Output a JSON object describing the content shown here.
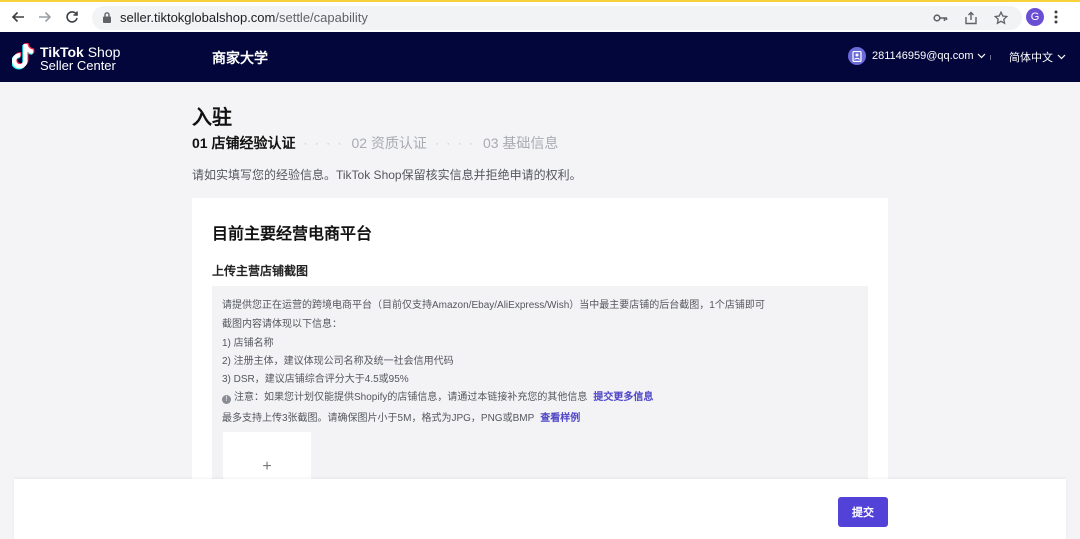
{
  "browser": {
    "url_host": "seller.tiktokglobalshop.com",
    "url_path": "/settle/capability",
    "profile_initial": "G",
    "icons": [
      "back-icon",
      "forward-icon",
      "reload-icon",
      "lock-icon",
      "key-icon",
      "share-icon",
      "star-icon",
      "kebab-menu-icon"
    ]
  },
  "header": {
    "brand_line1_bold": "TikTok",
    "brand_line1_thin": " Shop",
    "brand_line2": "Seller Center",
    "nav_university": "商家大学",
    "account_email": "281146959@qq.com",
    "language": "简体中文",
    "colors": {
      "background": "#03063a",
      "avatar": "#6a6bd8"
    }
  },
  "page": {
    "title": "入驻",
    "steps": [
      {
        "label": "01 店铺经验认证",
        "active": true
      },
      {
        "label": "02 资质认证",
        "active": false
      },
      {
        "label": "03 基础信息",
        "active": false
      }
    ],
    "step_separator": "· · · ·",
    "notice": "请如实填写您的经验信息。TikTok Shop保留核实信息并拒绝申请的权利。"
  },
  "card": {
    "title": "目前主要经营电商平台",
    "section_title": "上传主营店铺截图",
    "lines": {
      "intro": "请提供您正在运营的跨境电商平台（目前仅支持Amazon/Ebay/AliExpress/Wish）当中最主要店铺的后台截图，1个店铺即可",
      "content_required": "截图内容请体现以下信息：",
      "item1": "1) 店铺名称",
      "item2": "2) 注册主体，建议体现公司名称及统一社会信用代码",
      "item3": "3) DSR，建议店铺综合评分大于4.5或95%",
      "note": "注意：如果您计划仅能提供Shopify的店铺信息，请通过本链接补充您的其他信息",
      "note_link": "提交更多信息",
      "limit": "最多支持上传3张截图。请确保图片小于5M，格式为JPG，PNG或BMP",
      "limit_link": "查看样例"
    },
    "upload_symbol": "+"
  },
  "footer": {
    "submit_label": "提交",
    "accent_color": "#5242d8"
  }
}
